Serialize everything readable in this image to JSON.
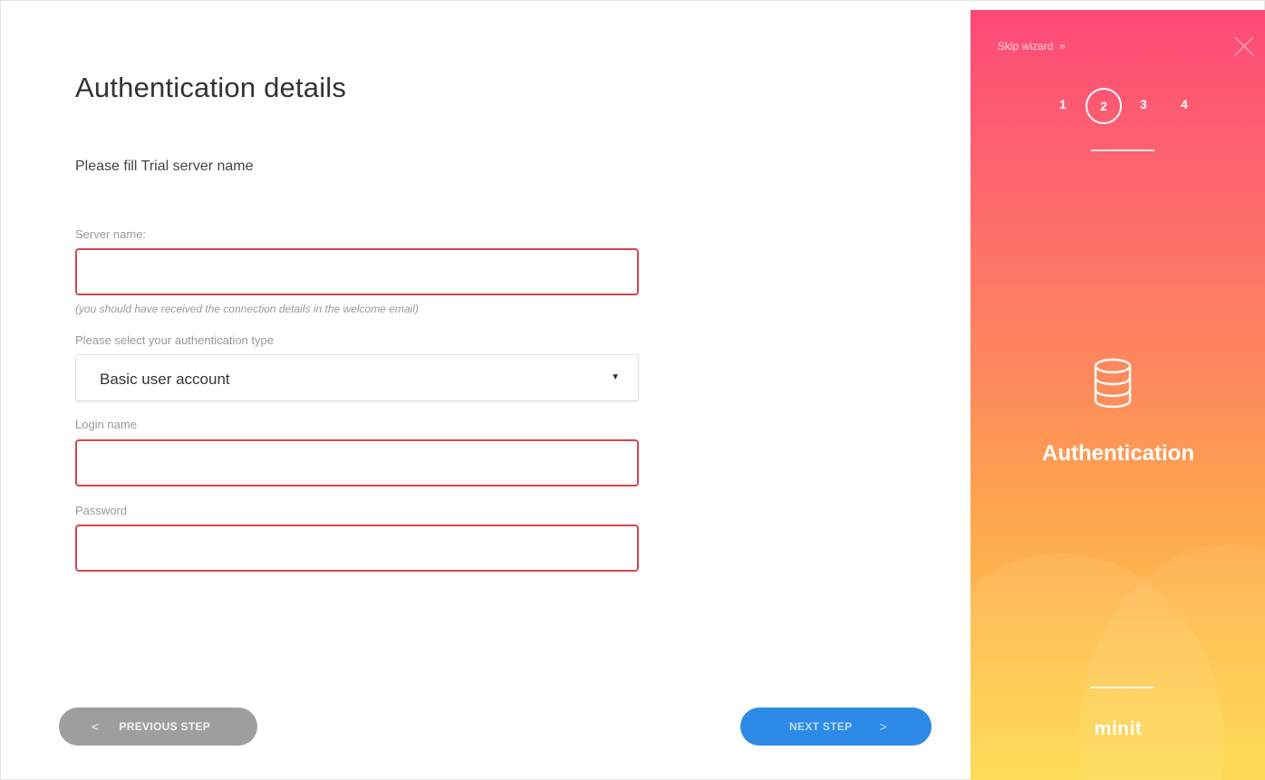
{
  "page": {
    "title": "Authentication details",
    "subtitle": "Please fill Trial server name"
  },
  "form": {
    "server_name_label": "Server name:",
    "server_name_value": "",
    "server_hint": "(you should have received the connection details in the welcome email)",
    "auth_type_label": "Please select your authentication type",
    "auth_type_value": "Basic user account",
    "login_label": "Login name",
    "login_value": "",
    "password_label": "Password",
    "password_value": ""
  },
  "buttons": {
    "previous_chevron": "<",
    "previous_label": "PREVIOUS STEP",
    "next_label": "NEXT STEP",
    "next_chevron": ">"
  },
  "sidebar": {
    "skip_label": "Skip wizard",
    "skip_icon": "double-chevron-right-icon",
    "steps": [
      "1",
      "2",
      "3",
      "4"
    ],
    "active_step": "2",
    "section_icon": "database-icon",
    "section_title": "Authentication",
    "logo_text": "minit"
  },
  "colors": {
    "error_border": "#d9434f",
    "prev_button": "#9e9e9e",
    "next_button": "#2d8ae6",
    "sidebar_gradient_top": "#fd4a78",
    "sidebar_gradient_bottom": "#fed94a"
  }
}
